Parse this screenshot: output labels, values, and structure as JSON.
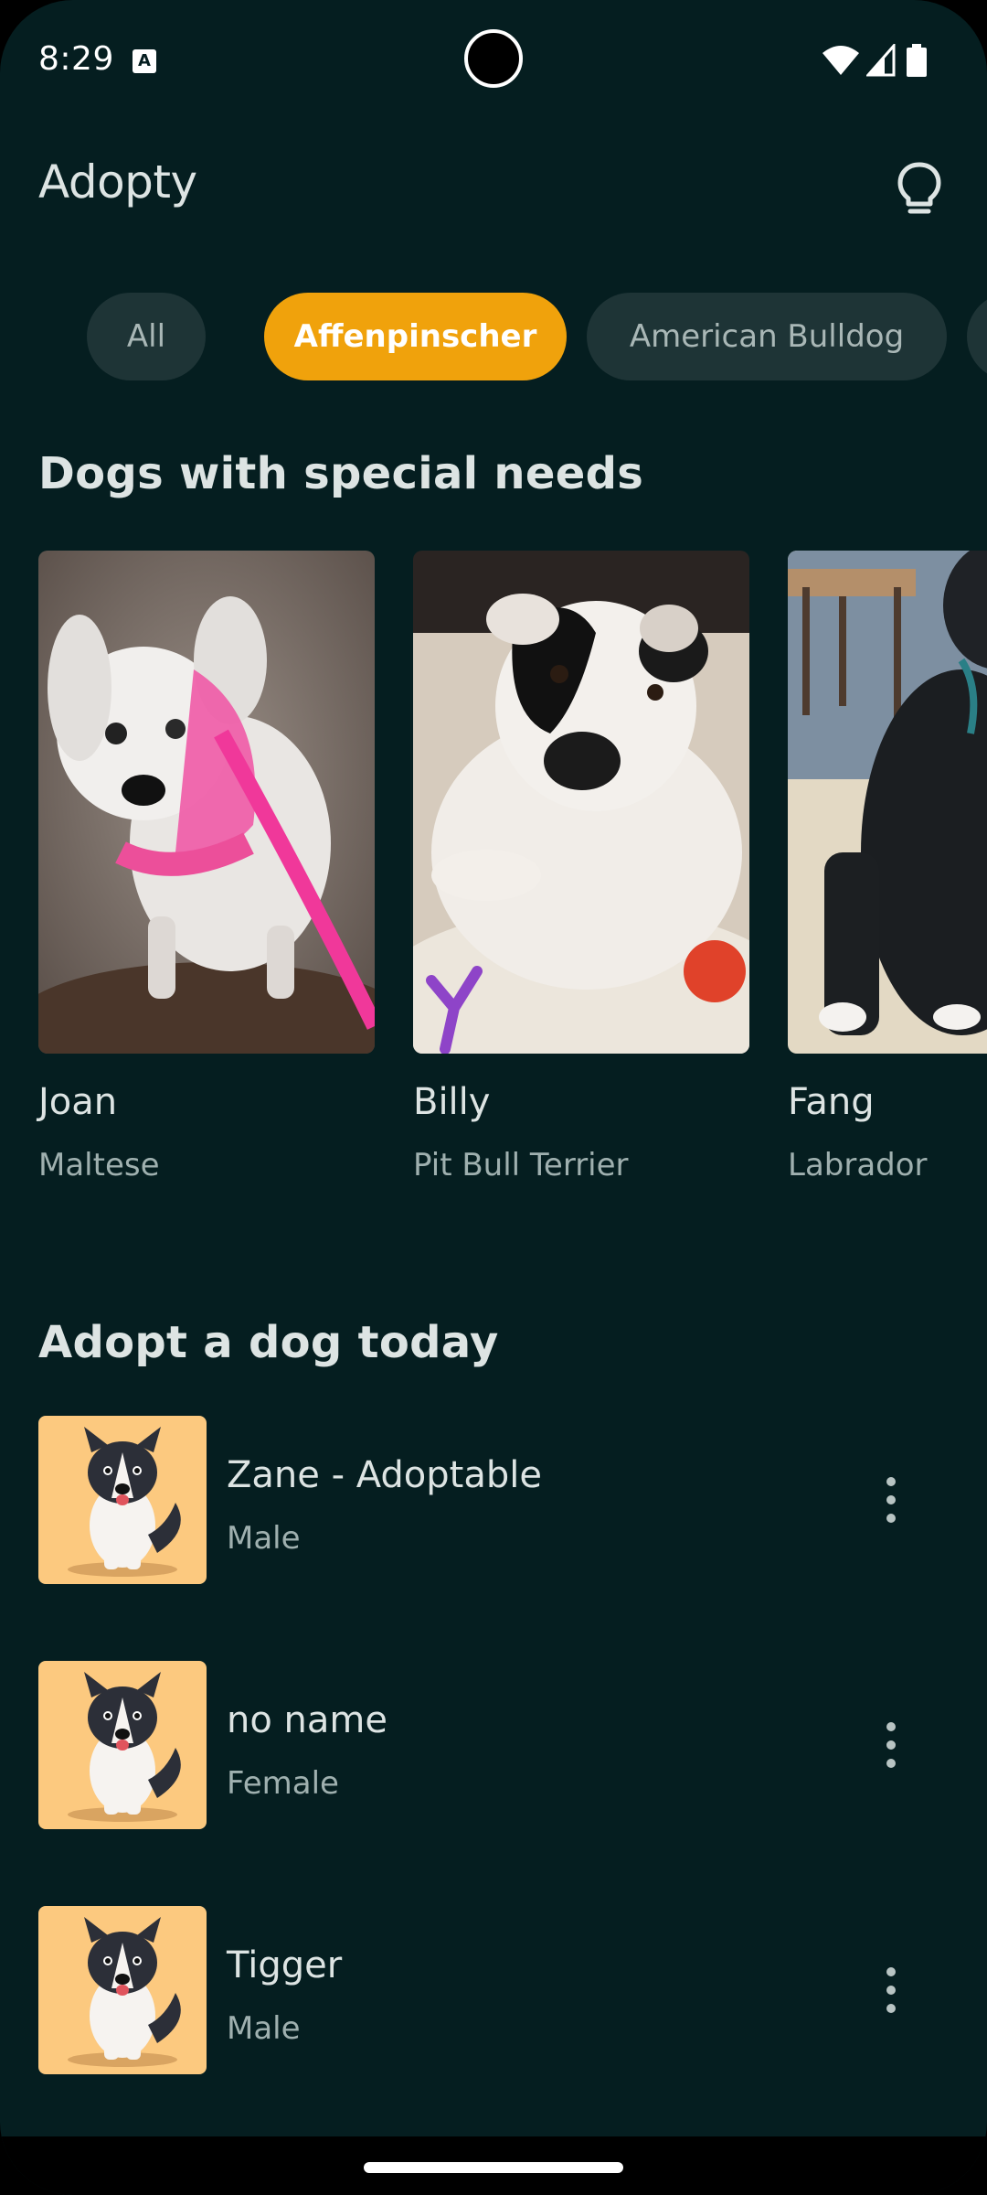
{
  "status_bar": {
    "time": "8:29",
    "notification_icon": "a-icon",
    "icons": [
      "wifi-icon",
      "cellular-signal-icon",
      "battery-icon"
    ]
  },
  "app_bar": {
    "title": "Adopty",
    "action_icon": "lightbulb-icon"
  },
  "breed_filters": {
    "chips": [
      {
        "label": "All",
        "selected": false
      },
      {
        "label": "Affenpinscher",
        "selected": true
      },
      {
        "label": "American Bulldog",
        "selected": false
      }
    ],
    "selected_color": "#f0a20c"
  },
  "special_needs": {
    "title": "Dogs with special needs",
    "dogs": [
      {
        "name": "Joan",
        "breed": "Maltese"
      },
      {
        "name": "Billy",
        "breed": "Pit Bull Terrier"
      },
      {
        "name": "Fang",
        "breed": "Labrador"
      }
    ]
  },
  "adopt_today": {
    "title": "Adopt a dog today",
    "dogs": [
      {
        "name": "Zane - Adoptable",
        "gender": "Male"
      },
      {
        "name": "no name",
        "gender": "Female"
      },
      {
        "name": "Tigger",
        "gender": "Male"
      }
    ]
  },
  "colors": {
    "background": "#051e20",
    "accent": "#f0a20c",
    "avatar_background": "#fcc97f"
  }
}
